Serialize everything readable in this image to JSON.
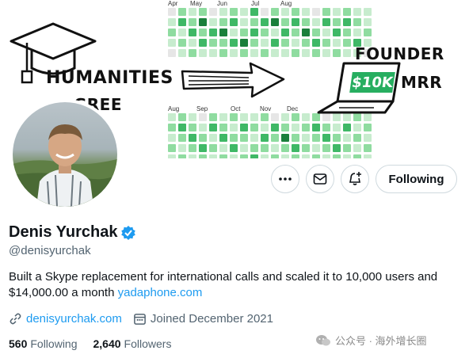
{
  "banner": {
    "left_text_1": "HUMANITIES",
    "left_text_2": "DEGREE",
    "right_text_1": "FOUNDER",
    "right_badge": "$10K",
    "right_text_2": "MRR",
    "top_months": [
      "Apr",
      "May",
      "Jun",
      "Jul",
      "Aug"
    ],
    "bottom_months": [
      "Aug",
      "Sep",
      "Oct",
      "Nov",
      "Dec"
    ],
    "top_grid": [
      [
        0,
        2,
        1,
        2,
        0,
        1,
        2,
        1,
        3,
        0,
        2,
        1,
        2,
        1,
        0,
        2,
        1,
        2,
        1,
        1
      ],
      [
        1,
        3,
        2,
        4,
        1,
        2,
        3,
        1,
        2,
        3,
        4,
        2,
        3,
        2,
        1,
        3,
        2,
        3,
        2,
        1
      ],
      [
        2,
        1,
        3,
        2,
        3,
        4,
        1,
        2,
        3,
        2,
        1,
        3,
        2,
        4,
        2,
        1,
        3,
        2,
        1,
        2
      ],
      [
        1,
        2,
        1,
        3,
        2,
        2,
        3,
        4,
        2,
        1,
        3,
        2,
        1,
        2,
        3,
        2,
        1,
        2,
        3,
        1
      ],
      [
        0,
        1,
        2,
        1,
        1,
        2,
        1,
        2,
        1,
        2,
        1,
        1,
        2,
        1,
        2,
        1,
        2,
        1,
        1,
        0
      ]
    ],
    "bottom_grid": [
      [
        1,
        2,
        1,
        0,
        2,
        1,
        2,
        1,
        1,
        2,
        0,
        1,
        2,
        1,
        2,
        0,
        1,
        1,
        2,
        1
      ],
      [
        2,
        3,
        2,
        1,
        3,
        2,
        1,
        3,
        2,
        1,
        3,
        2,
        1,
        2,
        3,
        2,
        1,
        3,
        1,
        2
      ],
      [
        1,
        2,
        3,
        2,
        1,
        3,
        2,
        2,
        1,
        3,
        2,
        4,
        2,
        1,
        2,
        3,
        2,
        1,
        2,
        1
      ],
      [
        2,
        1,
        2,
        3,
        2,
        1,
        3,
        1,
        2,
        2,
        1,
        2,
        3,
        2,
        1,
        2,
        3,
        2,
        1,
        2
      ],
      [
        1,
        2,
        1,
        2,
        1,
        2,
        1,
        2,
        3,
        1,
        2,
        1,
        2,
        1,
        2,
        1,
        2,
        1,
        2,
        1
      ]
    ]
  },
  "profile": {
    "name": "Denis Yurchak",
    "handle": "@denisyurchak",
    "bio_text": "Built a Skype replacement for international calls and scaled it to 10,000 users and $14,000.00 a month ",
    "bio_link": "yadaphone.com",
    "website": "denisyurchak.com",
    "joined": "Joined December 2021",
    "following_count": "560",
    "following_label": "Following",
    "followers_count": "2,640",
    "followers_label": "Followers",
    "verified_color": "#1d9bf0"
  },
  "actions": {
    "follow_label": "Following",
    "more_icon": "more-icon",
    "message_icon": "mail-icon",
    "notify_icon": "bell-plus-icon"
  },
  "watermark": "公众号 · 海外增长圈"
}
